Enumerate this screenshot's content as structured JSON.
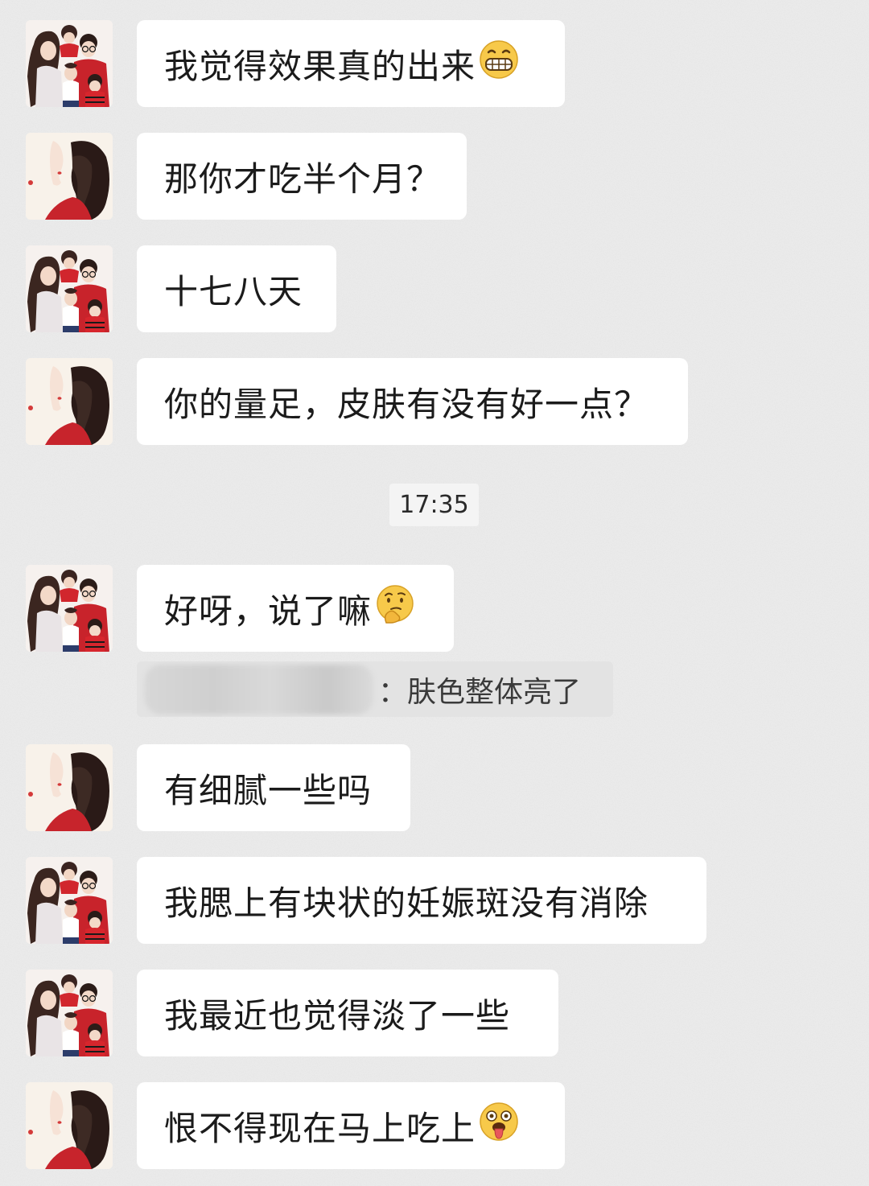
{
  "conversation": {
    "messages": [
      {
        "text": "我觉得效果真的出来",
        "sender": "self",
        "emoji": "grinning-face-icon"
      },
      {
        "text": "那你才吃半个月？",
        "sender": "other"
      },
      {
        "text": "十七八天",
        "sender": "self"
      },
      {
        "text": "你的量足，皮肤有没有好一点？",
        "sender": "other"
      },
      {
        "text": "好呀，说了嘛",
        "sender": "self",
        "emoji": "thinking-face-icon"
      },
      {
        "text": "有细腻一些吗",
        "sender": "other"
      },
      {
        "text": "我腮上有块状的妊娠斑没有消除",
        "sender": "self"
      },
      {
        "text": "我最近也觉得淡了一些",
        "sender": "self"
      },
      {
        "text": "恨不得现在马上吃上",
        "sender": "other",
        "emoji": "starstruck-tongue-face-icon"
      }
    ],
    "timestamp": "17:35",
    "quote": {
      "text": "：肤色整体亮了"
    }
  },
  "colors": {
    "background": "#ececec",
    "bubble": "#ffffff",
    "quote_bg": "#e3e3e3",
    "timestamp_bg": "#f4f4f4"
  }
}
